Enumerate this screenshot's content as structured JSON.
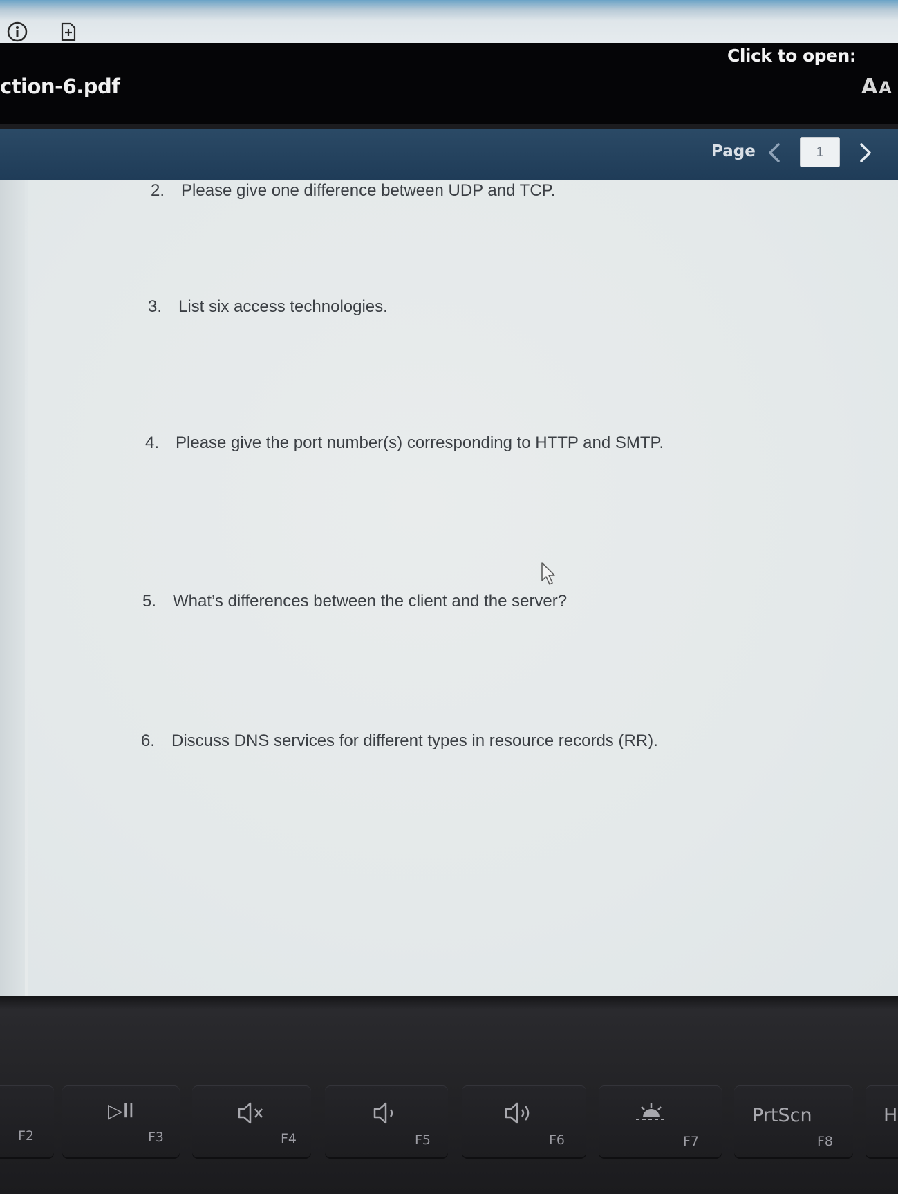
{
  "viewer": {
    "filename": "ction-6.pdf",
    "click_to_open": "Click to open:",
    "font_size_icon": "A",
    "font_size_icon_small": "A"
  },
  "pager": {
    "label": "Page",
    "current": "1"
  },
  "document": {
    "questions": [
      {
        "number": "2.",
        "text": "Please give one difference between UDP and TCP."
      },
      {
        "number": "3.",
        "text": "List six access technologies."
      },
      {
        "number": "4.",
        "text": "Please give the port number(s) corresponding to HTTP and SMTP."
      },
      {
        "number": "5.",
        "text": "What’s differences between the client and the server?"
      },
      {
        "number": "6.",
        "text": "Discuss DNS services for different types in resource records (RR)."
      }
    ]
  },
  "keyboard": {
    "keys": [
      {
        "label": "F2",
        "icon": "brightness-icon"
      },
      {
        "label": "F3",
        "icon": "play-pause-icon",
        "glyph": "▷II"
      },
      {
        "label": "F4",
        "icon": "mute-icon"
      },
      {
        "label": "F5",
        "icon": "volume-down-icon"
      },
      {
        "label": "F6",
        "icon": "volume-up-icon"
      },
      {
        "label": "F7",
        "icon": "keyboard-backlight-icon"
      },
      {
        "label": "F8",
        "icon": "print-screen-icon",
        "glyph": "PrtScn"
      },
      {
        "label": "",
        "icon": "home-key",
        "glyph": "H"
      }
    ]
  },
  "colors": {
    "header_bg": "#050507",
    "toolbar_bg": "#1f3c58",
    "page_bg": "#e4e9ea",
    "question_text": "#3b3f44"
  }
}
